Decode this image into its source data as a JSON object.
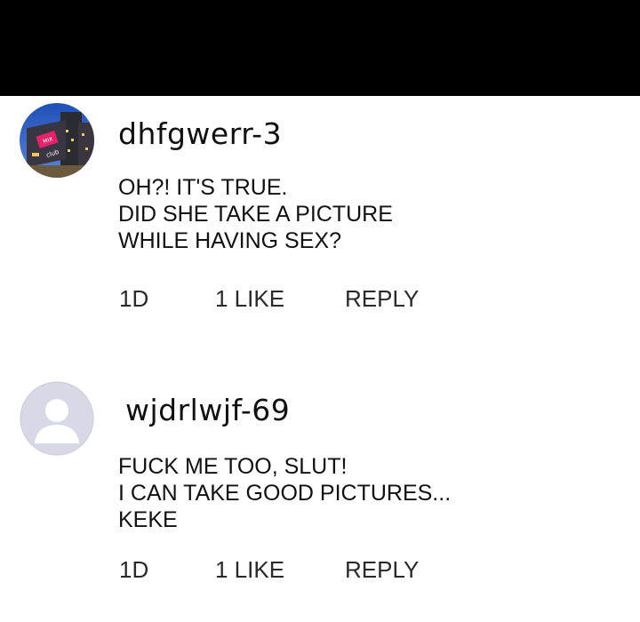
{
  "comments": [
    {
      "username": "dhfgwerr-3",
      "avatar": "building-photo-avatar",
      "avatar_text": [
        "MIX",
        "club"
      ],
      "lines": [
        "OH?! IT'S TRUE.",
        "DID SHE TAKE A PICTURE",
        "WHILE HAVING SEX?"
      ],
      "time": "1D",
      "likes": "1 LIKE",
      "reply": "REPLY"
    },
    {
      "username": "wjdrlwjf-69",
      "avatar": "default-user-avatar",
      "lines": [
        "FUCK ME TOO, SLUT!",
        "I CAN TAKE GOOD PICTURES...",
        "KEKE"
      ],
      "time": "1D",
      "likes": "1 LIKE",
      "reply": "REPLY"
    }
  ],
  "colors": {
    "top_bar": "#000000",
    "background": "#ffffff",
    "text": "#111111",
    "default_avatar_bg": "#d7d9e6",
    "default_avatar_fg": "#ffffff"
  }
}
